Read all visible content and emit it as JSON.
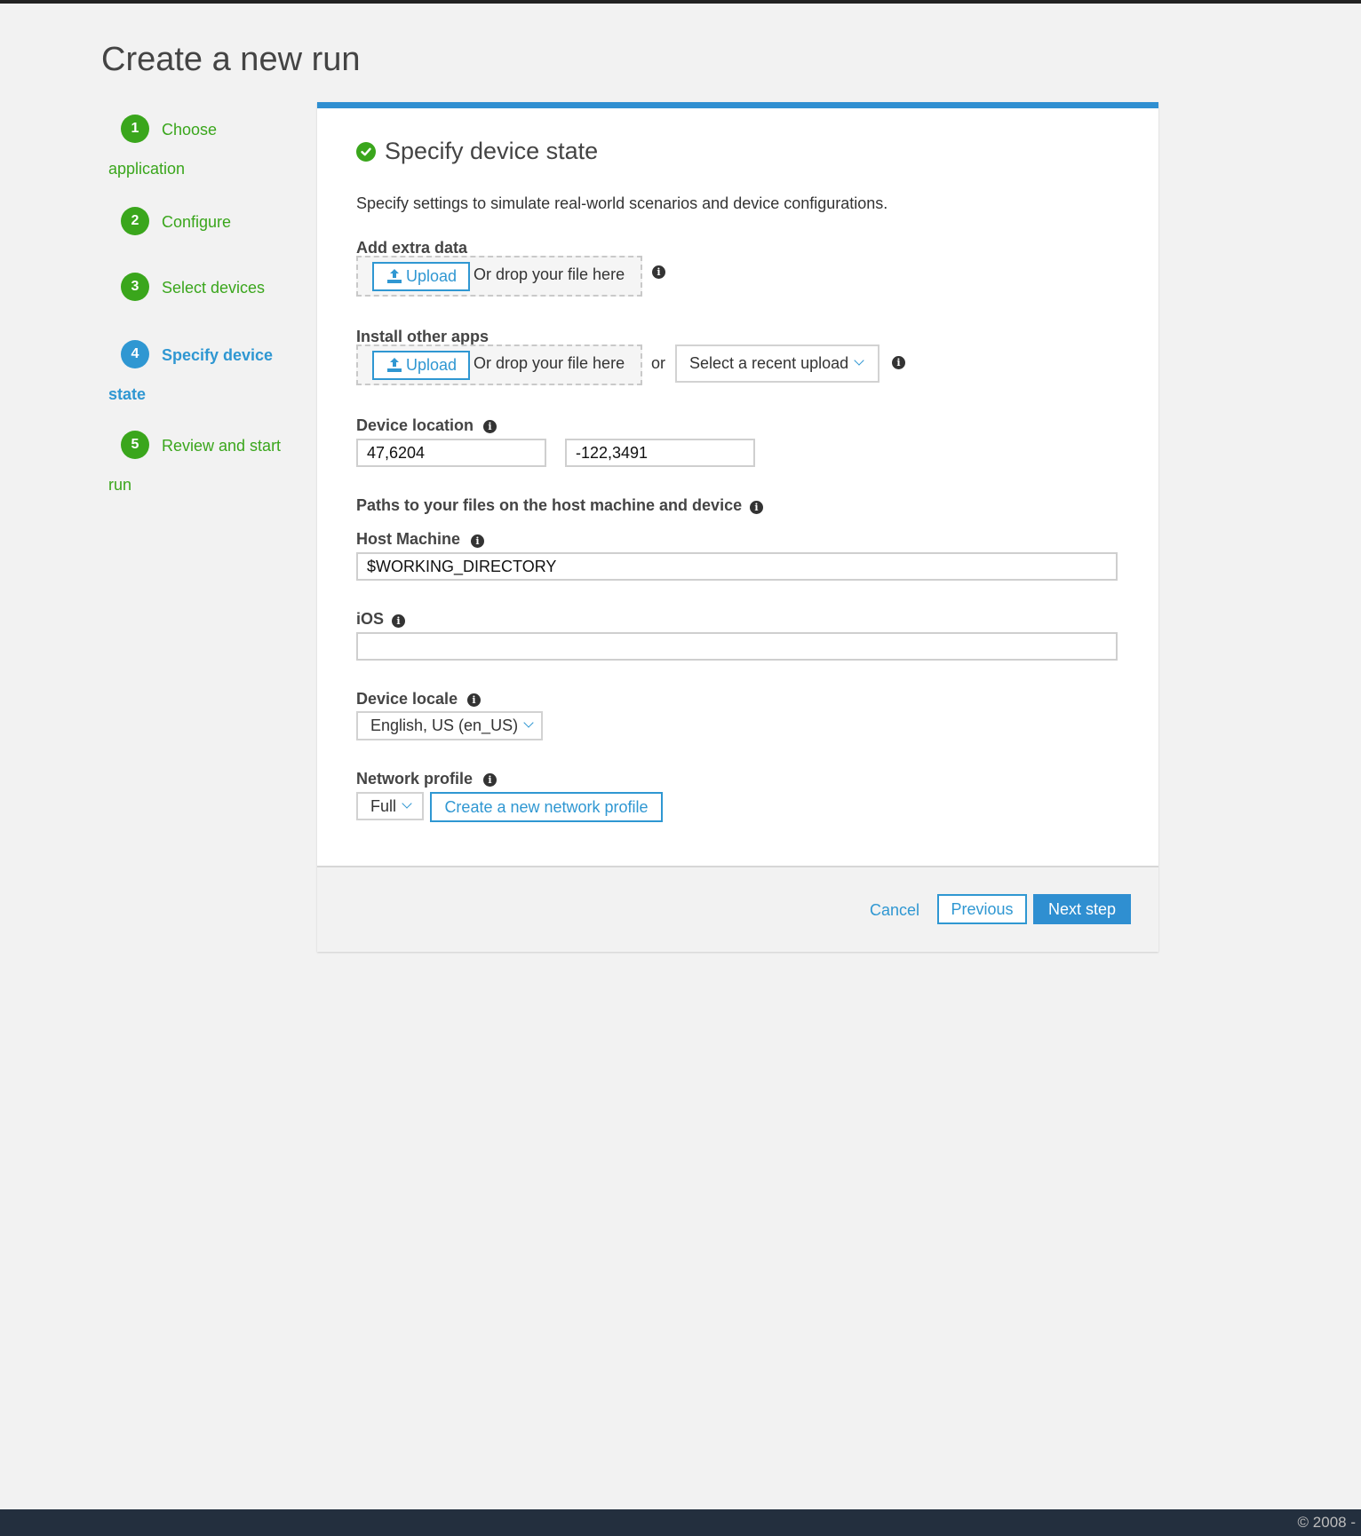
{
  "page": {
    "title": "Create a new run"
  },
  "steps": [
    {
      "number": "1",
      "label_line1": "Choose",
      "label_line2": "application",
      "state": "done"
    },
    {
      "number": "2",
      "label_line1": "Configure",
      "label_line2": "",
      "state": "done"
    },
    {
      "number": "3",
      "label_line1": "Select devices",
      "label_line2": "",
      "state": "done"
    },
    {
      "number": "4",
      "label_line1": "Specify device",
      "label_line2": "state",
      "state": "active"
    },
    {
      "number": "5",
      "label_line1": "Review and start",
      "label_line2": "run",
      "state": "done"
    }
  ],
  "panel": {
    "title": "Specify device state",
    "description": "Specify settings to simulate real-world scenarios and device configurations.",
    "extra_data": {
      "label": "Add extra data",
      "upload_label": "Upload",
      "drop_text": "Or drop your file here"
    },
    "other_apps": {
      "label": "Install other apps",
      "upload_label": "Upload",
      "drop_text": "Or drop your file here",
      "or_text": "or",
      "recent_upload_label": "Select a recent upload"
    },
    "device_location": {
      "label": "Device location",
      "latitude": "47,6204",
      "longitude": "-122,3491"
    },
    "paths": {
      "label": "Paths to your files on the host machine and device",
      "host_label": "Host Machine",
      "host_value": "$WORKING_DIRECTORY",
      "ios_label": "iOS",
      "ios_value": ""
    },
    "locale": {
      "label": "Device locale",
      "selected": "English, US (en_US)"
    },
    "network": {
      "label": "Network profile",
      "selected": "Full",
      "create_label": "Create a new network profile"
    },
    "footer": {
      "cancel": "Cancel",
      "previous": "Previous",
      "next": "Next step"
    }
  },
  "footer": {
    "copyright": "© 2008 -"
  },
  "colors": {
    "accent_blue": "#2f97d2",
    "success_green": "#3aa61c",
    "footer_dark": "#232f3e"
  }
}
